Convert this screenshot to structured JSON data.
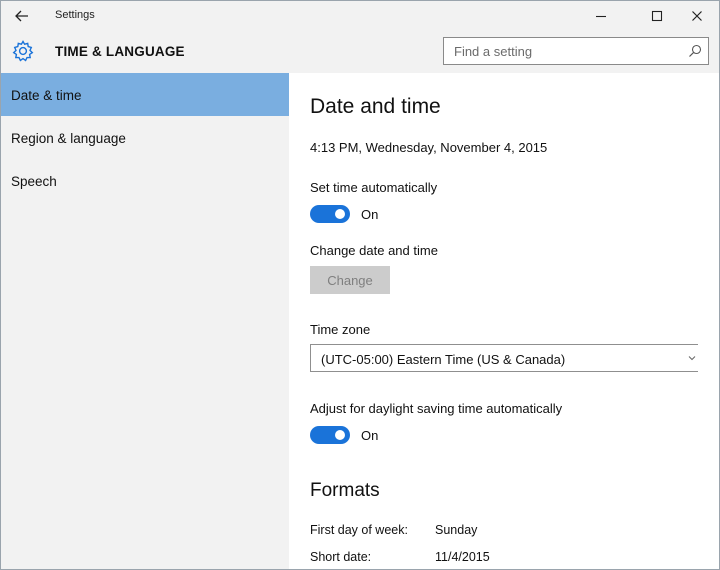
{
  "window": {
    "title": "Settings"
  },
  "header": {
    "title": "TIME & LANGUAGE",
    "search_placeholder": "Find a setting"
  },
  "sidebar": {
    "items": [
      {
        "label": "Date & time",
        "active": true
      },
      {
        "label": "Region & language",
        "active": false
      },
      {
        "label": "Speech",
        "active": false
      }
    ]
  },
  "main": {
    "title": "Date and time",
    "current_datetime": "4:13 PM, Wednesday, November 4, 2015",
    "set_time_auto": {
      "label": "Set time automatically",
      "state": "On"
    },
    "change_datetime": {
      "label": "Change date and time",
      "button_label": "Change"
    },
    "time_zone": {
      "label": "Time zone",
      "value": "(UTC-05:00) Eastern Time (US & Canada)"
    },
    "daylight": {
      "label": "Adjust for daylight saving time automatically",
      "state": "On"
    },
    "formats": {
      "title": "Formats",
      "rows": [
        {
          "key": "First day of week:",
          "value": "Sunday"
        },
        {
          "key": "Short date:",
          "value": "11/4/2015"
        }
      ]
    }
  },
  "colors": {
    "accent": "#1a73d9",
    "sidebar_selected": "#7aaee0",
    "chrome_background": "#f2f2f2",
    "content_background": "#ffffff",
    "disabled_button": "#cccccc"
  },
  "icons": {
    "back": "arrow-left-icon",
    "minimize": "minimize-icon",
    "maximize": "maximize-icon",
    "close": "close-icon",
    "header": "gear-icon",
    "search": "search-icon",
    "dropdown": "chevron-down-icon"
  }
}
